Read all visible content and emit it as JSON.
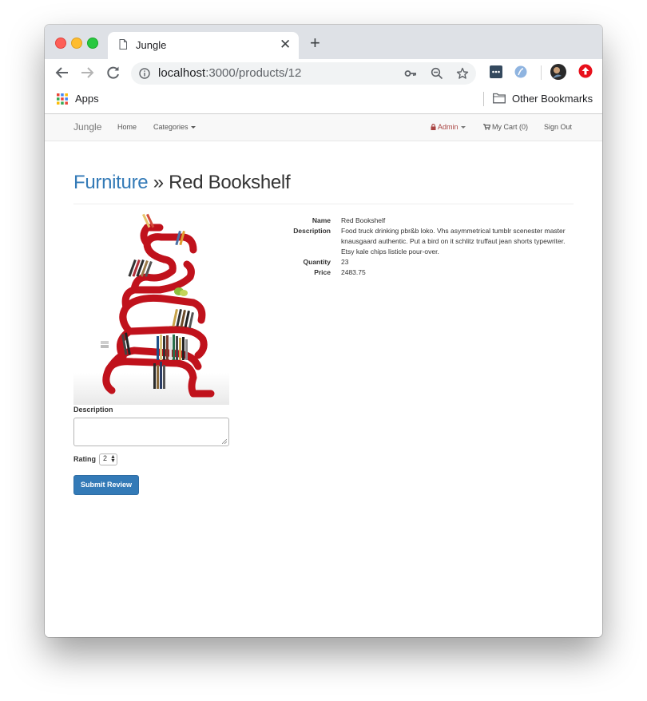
{
  "browser": {
    "tab_title": "Jungle",
    "url_host": "localhost",
    "url_path": ":3000/products/12",
    "bookmarks": {
      "apps": "Apps",
      "other": "Other Bookmarks"
    }
  },
  "navbar": {
    "brand": "Jungle",
    "home": "Home",
    "categories": "Categories",
    "admin": "Admin",
    "cart": "My Cart (0)",
    "signout": "Sign Out"
  },
  "product": {
    "category": "Furniture",
    "separator": " » ",
    "title": "Red Bookshelf",
    "details": [
      {
        "label": "Name",
        "value": "Red Bookshelf"
      },
      {
        "label": "Description",
        "value": "Food truck drinking pbr&b loko. Vhs asymmetrical tumblr scenester master knausgaard authentic. Put a bird on it schlitz truffaut jean shorts typewriter. Etsy kale chips listicle pour-over."
      },
      {
        "label": "Quantity",
        "value": "23"
      },
      {
        "label": "Price",
        "value": "2483.75"
      }
    ]
  },
  "review_form": {
    "description_label": "Description",
    "description_value": "",
    "rating_label": "Rating",
    "rating_value": "2",
    "submit_label": "Submit Review"
  },
  "colors": {
    "link": "#337ab7",
    "admin": "#a94442",
    "shelf": "#c0121c"
  }
}
